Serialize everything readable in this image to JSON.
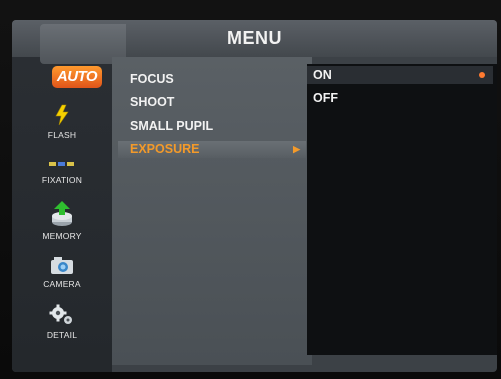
{
  "menu": {
    "title": "MENU"
  },
  "sidebar": {
    "auto_label": "AUTO",
    "items": [
      {
        "label": "FLASH",
        "icon": "flash-icon"
      },
      {
        "label": "FIXATION",
        "icon": "fixation-icon"
      },
      {
        "label": "MEMORY",
        "icon": "memory-icon"
      },
      {
        "label": "CAMERA",
        "icon": "camera-icon"
      },
      {
        "label": "DETAIL",
        "icon": "gear-icon"
      }
    ]
  },
  "main": {
    "items": [
      {
        "label": "FOCUS"
      },
      {
        "label": "SHOOT"
      },
      {
        "label": "SMALL PUPIL"
      },
      {
        "label": "EXPOSURE",
        "selected": true
      }
    ]
  },
  "submenu": {
    "items": [
      {
        "label": "ON",
        "selected": true
      },
      {
        "label": "OFF"
      }
    ]
  },
  "colors": {
    "accent": "#f39a2a",
    "auto_badge": "#e0541a",
    "screen_bg": "#3c4146"
  }
}
